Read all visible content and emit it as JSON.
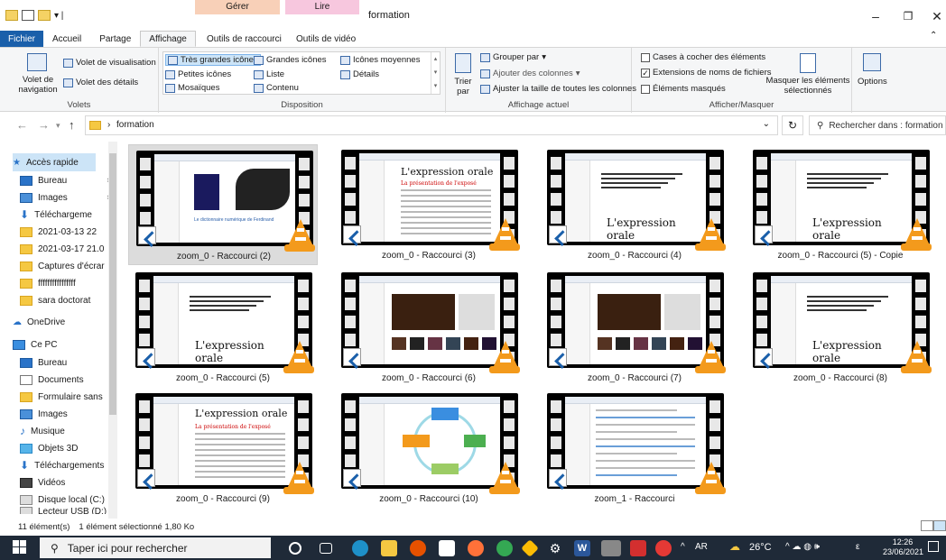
{
  "window": {
    "title": "formation",
    "contextual_tabs": [
      {
        "header": "Gérer",
        "tab": "Outils de raccourci"
      },
      {
        "header": "Lire",
        "tab": "Outils de vidéo"
      }
    ]
  },
  "tabs": [
    "Fichier",
    "Accueil",
    "Partage",
    "Affichage"
  ],
  "ribbon": {
    "volets": {
      "nav_pane": "Volet de navigation",
      "preview": "Volet de visualisation",
      "details": "Volet des détails",
      "label": "Volets"
    },
    "disposition": {
      "items": [
        "Très grandes icônes",
        "Grandes icônes",
        "Icônes moyennes",
        "Petites icônes",
        "Liste",
        "Détails",
        "Mosaïques",
        "Contenu"
      ],
      "label": "Disposition"
    },
    "affichage_actuel": {
      "sort": "Trier par",
      "group": "Grouper par",
      "add_columns": "Ajouter des colonnes",
      "fit_columns": "Ajuster la taille de toutes les colonnes",
      "label": "Affichage actuel"
    },
    "afficher_masquer": {
      "checkboxes": "Cases à cocher des éléments",
      "extensions": "Extensions de noms de fichiers",
      "hidden": "Éléments masqués",
      "hide_selected": "Masquer les éléments sélectionnés",
      "label": "Afficher/Masquer"
    },
    "options": "Options"
  },
  "address": {
    "path": "formation",
    "search_placeholder": "Rechercher dans : formation"
  },
  "nav_pane": {
    "quick_access": "Accès rapide",
    "quick_items": [
      "Bureau",
      "Images",
      "Téléchargeme",
      "2021-03-13 22",
      "2021-03-17 21.0",
      "Captures d'écrar",
      "ffffffffffffffff",
      "sara doctorat"
    ],
    "onedrive": "OneDrive",
    "this_pc": "Ce PC",
    "pc_items": [
      "Bureau",
      "Documents",
      "Formulaire sans",
      "Images",
      "Musique",
      "Objets 3D",
      "Téléchargements",
      "Vidéos",
      "Disque local (C:)",
      "Lecteur USB (D:)"
    ]
  },
  "files": [
    {
      "name": "zoom_0 - Raccourci (2)",
      "type": "dark",
      "selected": true
    },
    {
      "name": "zoom_0 - Raccourci (3)",
      "type": "doc"
    },
    {
      "name": "zoom_0 - Raccourci (4)",
      "type": "title"
    },
    {
      "name": "zoom_0 - Raccourci (5) - Copie",
      "type": "title"
    },
    {
      "name": "zoom_0 - Raccourci (5)",
      "type": "title"
    },
    {
      "name": "zoom_0 - Raccourci (6)",
      "type": "video"
    },
    {
      "name": "zoom_0 - Raccourci (7)",
      "type": "video"
    },
    {
      "name": "zoom_0 - Raccourci (8)",
      "type": "title"
    },
    {
      "name": "zoom_0 - Raccourci (9)",
      "type": "doc2"
    },
    {
      "name": "zoom_0 - Raccourci (10)",
      "type": "diagram"
    },
    {
      "name": "zoom_1 - Raccourci",
      "type": "table"
    }
  ],
  "thumb_text": {
    "expression": "L'expression orale",
    "presentation": "La présentation de l'exposé",
    "dictionary": "Le dictionnaire numérique de Ferdinand"
  },
  "status": {
    "count": "11 élément(s)",
    "selection": "1 élément sélectionné  1,80 Ko"
  },
  "taskbar": {
    "search": "Taper ici pour rechercher",
    "lang": "AR",
    "weather": "26°C",
    "input": "ε",
    "time": "12:26",
    "date": "23/06/2021"
  }
}
